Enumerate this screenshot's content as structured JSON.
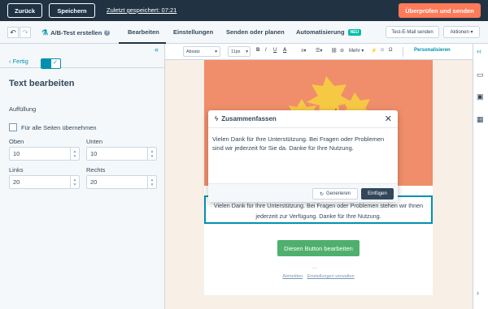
{
  "topbar": {
    "back_label": "Zurück",
    "save_label": "Speichern",
    "saved_text": "Zuletzt gespeichert: 07:21",
    "review_label": "Überprüfen und senden"
  },
  "secondary": {
    "ab_test_label": "A/B-Test erstellen",
    "tabs": [
      {
        "label": "Bearbeiten"
      },
      {
        "label": "Einstellungen"
      },
      {
        "label": "Senden oder planen"
      },
      {
        "label": "Automatisierung"
      }
    ],
    "new_badge": "NEU",
    "test_email_label": "Test-E-Mail senden",
    "actions_label": "Aktionen"
  },
  "panel": {
    "back_link": "Fertig",
    "title": "Text bearbeiten",
    "padding_label": "Auffüllung",
    "apply_all_label": "Für alle Seiten übernehmen",
    "fields": {
      "top": {
        "label": "Oben",
        "value": "10"
      },
      "bottom": {
        "label": "Unten",
        "value": "10"
      },
      "left": {
        "label": "Links",
        "value": "20"
      },
      "right": {
        "label": "Rechts",
        "value": "20"
      }
    }
  },
  "richtext": {
    "style_value": "Absatz",
    "size_value": "11px",
    "bold": "B",
    "italic": "I",
    "underline": "U",
    "color": "A",
    "more_label": "Mehr",
    "personalize_label": "Personalisieren"
  },
  "email": {
    "body_text": "Vielen Dank für Ihre Unterstützung. Bei Fragen oder Problemen stehen wir Ihnen jederzeit zur Verfügung. Danke für Ihre Nutzung.",
    "button_label": "Diesen Button bearbeiten",
    "ellipsis": "...",
    "footer_unsubscribe": "Abmelden",
    "footer_settings": "Einstellungen verwalten"
  },
  "modal": {
    "title": "Zusammenfassen",
    "body": "Vielen Dank für Ihre Unterstützung. Bei Fragen oder Problemen sind wir jederzeit für Sie da. Danke für Ihre Nutzung.",
    "generate_label": "Generieren",
    "insert_label": "Einfügen"
  },
  "colors": {
    "topbar_bg": "#213343",
    "accent_orange": "#ff7a59",
    "accent_teal": "#0091ae",
    "cta_green": "#4fb06d",
    "hero_orange": "#f08e6b"
  }
}
